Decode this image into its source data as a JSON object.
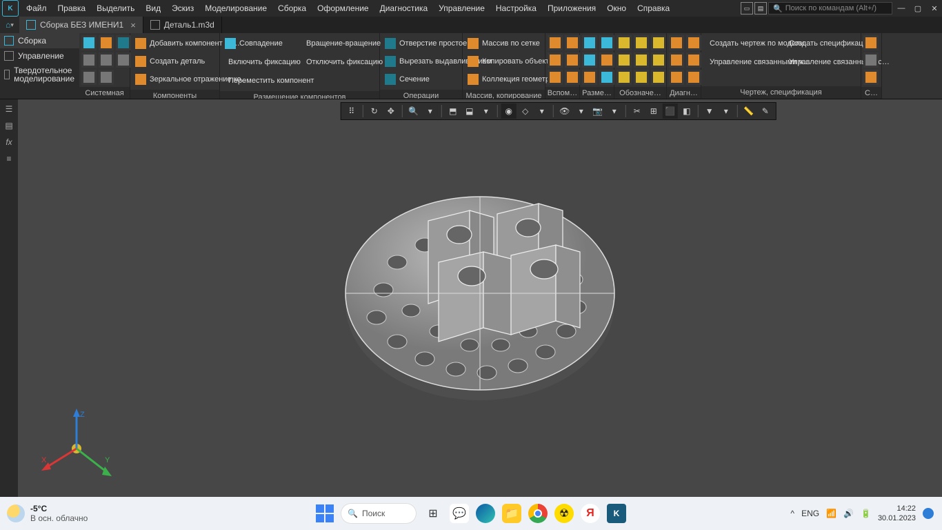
{
  "menubar": {
    "items": [
      "Файл",
      "Правка",
      "Выделить",
      "Вид",
      "Эскиз",
      "Моделирование",
      "Сборка",
      "Оформление",
      "Диагностика",
      "Управление",
      "Настройка",
      "Приложения",
      "Окно",
      "Справка"
    ],
    "search_placeholder": "Поиск по командам (Alt+/)"
  },
  "tabs": [
    {
      "label": "Сборка БЕЗ ИМЕНИ1",
      "active": true
    },
    {
      "label": "Деталь1.m3d",
      "active": false
    }
  ],
  "left_tabs": [
    {
      "label": "Сборка",
      "active": true
    },
    {
      "label": "Управление",
      "active": false
    },
    {
      "label": "Твердотельное моделирование",
      "active": false
    }
  ],
  "ribbon": {
    "groups": {
      "system": "Системная",
      "components": "Компоненты",
      "placement": "Размещение компонентов",
      "operations": "Операции",
      "array": "Массив, копирование",
      "aux": "Вспом…",
      "dims": "Разме…",
      "labels": "Обозначе…",
      "diag": "Диагн…",
      "drawing": "Чертеж, спецификация",
      "s": "С…"
    },
    "components_btns": {
      "add": "Добавить компонент из…",
      "create_part": "Создать деталь",
      "mirror": "Зеркальное отражение ко…"
    },
    "placement_btns": {
      "match": "Совпадение",
      "enable_fix": "Включить фиксацию",
      "move": "Переместить компонент",
      "rotation": "Вращение-вращение",
      "disable_fix": "Отключить фиксацию"
    },
    "operations_btns": {
      "hole": "Отверстие простое",
      "extrude_cut": "Вырезать выдавливанием",
      "section": "Сечение"
    },
    "array_btns": {
      "grid_array": "Массив по сетке",
      "copy_objects": "Копировать объекты",
      "geom_collection": "Коллекция геометрии"
    },
    "drawing_btns": {
      "create_drawing": "Создать чертеж по модели",
      "manage_linked": "Управление связанными ч…",
      "create_spec": "Создать спецификаци…",
      "manage_spec": "Управление связанными с…"
    }
  },
  "taskbar": {
    "temp": "-5°C",
    "weather_desc": "В осн. облачно",
    "search": "Поиск",
    "lang": "ENG",
    "time": "14:22",
    "date": "30.01.2023"
  }
}
